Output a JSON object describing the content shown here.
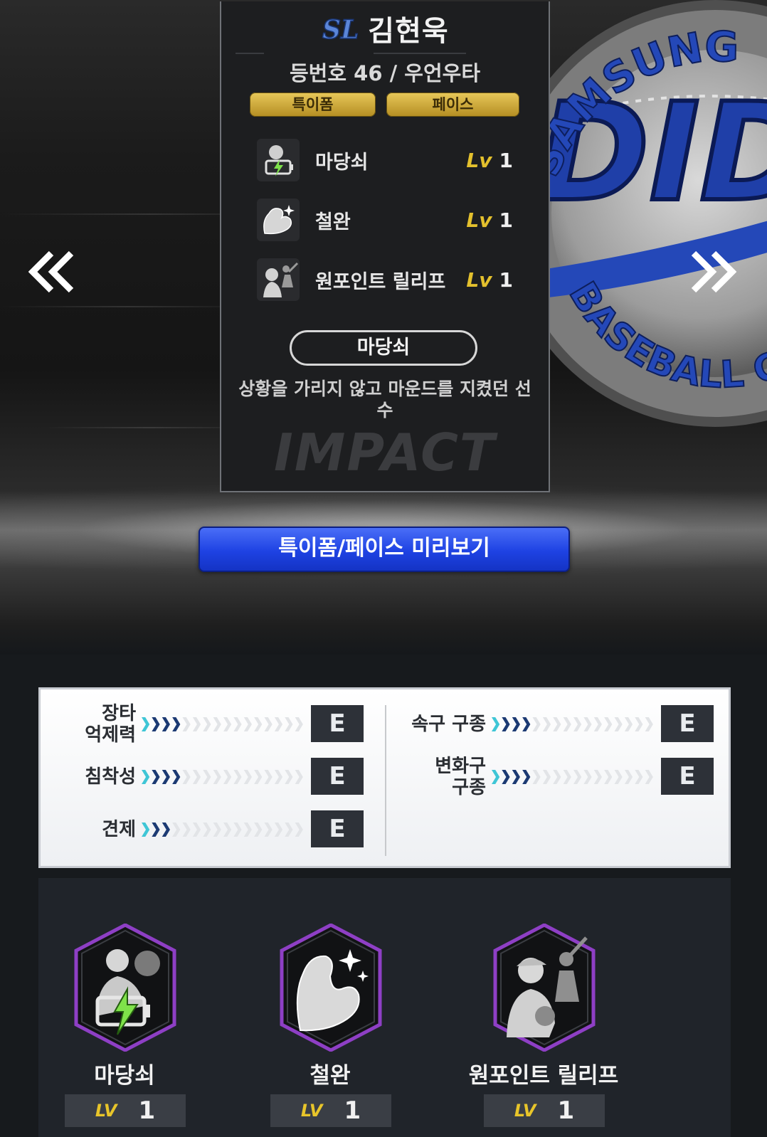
{
  "player": {
    "name": "김현욱",
    "team_logo_text": "SL",
    "info": "등번호 46 / 우언우타"
  },
  "card_tabs": {
    "trait": "특이폼",
    "face": "페이스"
  },
  "skills": [
    {
      "name": "마당쇠",
      "lv_label": "Lv",
      "level": "1",
      "icon": "battery-charge-icon"
    },
    {
      "name": "철완",
      "lv_label": "Lv",
      "level": "1",
      "icon": "flexed-arm-icon"
    },
    {
      "name": "원포인트 릴리프",
      "lv_label": "Lv",
      "level": "1",
      "icon": "pitcher-batter-icon"
    }
  ],
  "selected_skill": {
    "name": "마당쇠",
    "description": "상황을 가리지 않고 마운드를 지켰던 선수"
  },
  "card_watermark": "IMPACT",
  "emblem": {
    "top_text": "SAMSUNG",
    "bottom_text": "BASEBALL CLUB"
  },
  "preview_button": "특이폼/페이스 미리보기",
  "stats": {
    "left": [
      {
        "label": "장타\n억제력",
        "grade": "E",
        "filled": 4
      },
      {
        "label": "침착성",
        "grade": "E",
        "filled": 4
      },
      {
        "label": "견제",
        "grade": "E",
        "filled": 3
      }
    ],
    "right": [
      {
        "label": "속구 구종",
        "grade": "E",
        "filled": 4
      },
      {
        "label": "변화구\n구종",
        "grade": "E",
        "filled": 4
      }
    ],
    "total_segments": 16
  },
  "skill_cards": [
    {
      "name": "마당쇠",
      "lv_label": "LV",
      "level": "1",
      "icon": "battery-charge-icon"
    },
    {
      "name": "철완",
      "lv_label": "LV",
      "level": "1",
      "icon": "flexed-arm-icon"
    },
    {
      "name": "원포인트 릴리프",
      "lv_label": "LV",
      "level": "1",
      "icon": "pitcher-batter-icon"
    }
  ],
  "colors": {
    "accent_gold": "#e3c02d",
    "button_blue": "#1e42e3",
    "badge_purple": "#8e3fc5",
    "arrow_cyan": "#3fc6d6",
    "arrow_navy": "#1c3a73"
  }
}
